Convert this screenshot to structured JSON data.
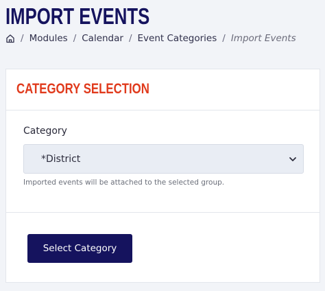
{
  "page": {
    "title": "IMPORT EVENTS"
  },
  "breadcrumb": {
    "home_icon": "home-icon",
    "items": [
      "Modules",
      "Calendar",
      "Event Categories"
    ],
    "current": "Import Events",
    "separator": "/"
  },
  "card": {
    "title": "CATEGORY SELECTION",
    "field_label": "Category",
    "select_value": "*District",
    "help_text": "Imported events will be attached to the selected group.",
    "button_label": "Select Category"
  },
  "colors": {
    "brand": "#15135e",
    "accent": "#e03a1c",
    "background": "#f2f4f8"
  }
}
